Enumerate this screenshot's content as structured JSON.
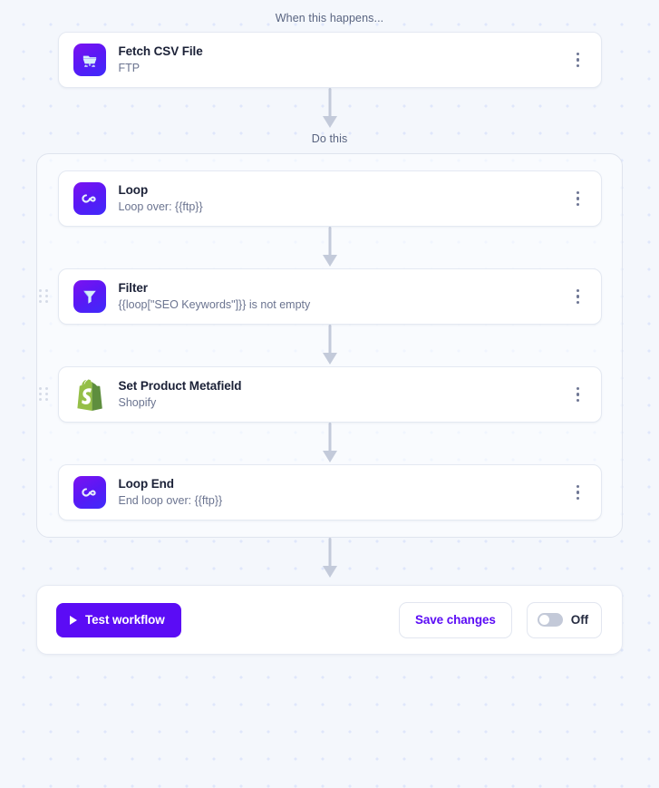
{
  "sections": {
    "trigger_label": "When this happens...",
    "action_label": "Do this"
  },
  "trigger": {
    "title": "Fetch CSV File",
    "subtitle": "FTP",
    "icon": "ftp-server-icon"
  },
  "steps": [
    {
      "title": "Loop",
      "subtitle": "Loop over: {{ftp}}",
      "icon": "infinity-loop-icon",
      "has_drag_handle": false
    },
    {
      "title": "Filter",
      "subtitle": "{{loop[\"SEO Keywords\"]}} is not empty",
      "icon": "funnel-filter-icon",
      "has_drag_handle": true
    },
    {
      "title": "Set Product Metafield",
      "subtitle": "Shopify",
      "icon": "shopify-bag-icon",
      "has_drag_handle": true
    },
    {
      "title": "Loop End",
      "subtitle": "End loop over: {{ftp}}",
      "icon": "infinity-loop-icon",
      "has_drag_handle": false
    }
  ],
  "action_bar": {
    "test_label": "Test workflow",
    "save_label": "Save changes",
    "toggle_label": "Off",
    "toggle_state": "off"
  },
  "colors": {
    "accent": "#5b0cf5",
    "canvas_bg": "#f4f7fc",
    "dot_grid": "#dfe7fb",
    "card_border": "#e4e9f2",
    "title_text": "#1b2137",
    "sub_text": "#6b7490",
    "arrow": "#c3cada",
    "shopify_green": "#95bf47"
  }
}
